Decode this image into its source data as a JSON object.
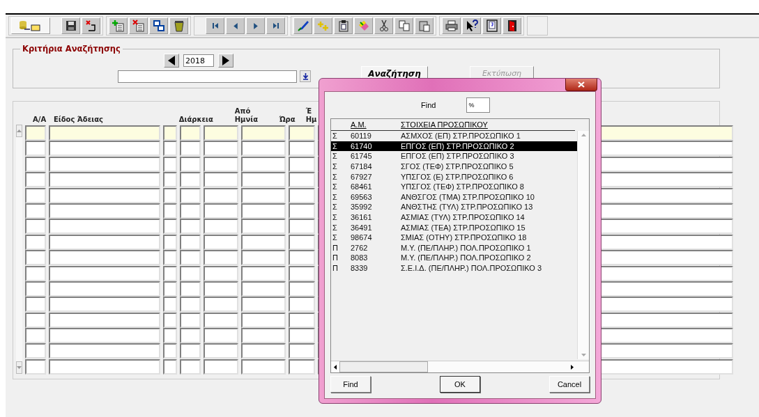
{
  "search_criteria": {
    "title": "Κριτήρια Αναζήτησης",
    "year": "2018",
    "search_button": "Αναζήτηση",
    "print_button": {
      "label": "Εκτύπωση",
      "disabled": true
    }
  },
  "grid": {
    "columns": [
      {
        "lines": [
          "Α/Α"
        ]
      },
      {
        "lines": [
          "Είδος Άδειας"
        ]
      },
      {},
      {
        "lines": [
          "Διάρκεια"
        ]
      },
      {},
      {
        "lines": [
          "Από",
          "Ημνία"
        ]
      },
      {
        "lines": [
          "Ώρα"
        ]
      },
      {
        "lines": [
          "Έ",
          "Ημ"
        ]
      }
    ],
    "rows": [
      {
        "selected": true
      },
      {
        "selected": false
      },
      {
        "selected": false
      },
      {
        "selected": false
      },
      {
        "selected": false
      },
      {
        "selected": false
      },
      {
        "selected": false
      },
      {
        "selected": false
      },
      {
        "selected": false
      },
      {
        "selected": false
      },
      {
        "selected": false
      },
      {
        "selected": false
      },
      {
        "selected": false
      },
      {
        "selected": false
      },
      {
        "selected": false
      },
      {
        "selected": false
      }
    ]
  },
  "dialog": {
    "find_label": "Find",
    "find_value": "%",
    "columns": [
      "Α.Μ.",
      "ΣΤΟΙΧΕΙΑ ΠΡΟΣΩΠΙΚΟΥ"
    ],
    "rows": [
      {
        "type": "Σ",
        "am": "60119",
        "name": "ΑΣΜΧΟΣ (ΕΠ) ΣΤΡ.ΠΡΟΣΩΠΙΚΟ 1",
        "selected": false
      },
      {
        "type": "Σ",
        "am": "61740",
        "name": "ΕΠΓΟΣ (ΕΠ) ΣΤΡ.ΠΡΟΣΩΠΙΚΟ 2",
        "selected": true
      },
      {
        "type": "Σ",
        "am": "61745",
        "name": "ΕΠΓΟΣ (ΕΠ) ΣΤΡ.ΠΡΟΣΩΠΙΚΟ 3",
        "selected": false
      },
      {
        "type": "Σ",
        "am": "67184",
        "name": "ΣΓΟΣ (ΤΕΦ) ΣΤΡ.ΠΡΟΣΩΠΙΚΟ 5",
        "selected": false
      },
      {
        "type": "Σ",
        "am": "67927",
        "name": "ΥΠΣΓΟΣ (Ε) ΣΤΡ.ΠΡΟΣΩΠΙΚΟ 6",
        "selected": false
      },
      {
        "type": "Σ",
        "am": "68461",
        "name": "ΥΠΣΓΟΣ (ΤΕΦ) ΣΤΡ.ΠΡΟΣΩΠΙΚΟ 8",
        "selected": false
      },
      {
        "type": "Σ",
        "am": "69563",
        "name": "ΑΝΘΣΓΟΣ (ΤΜΑ) ΣΤΡ.ΠΡΟΣΩΠΙΚΟ 10",
        "selected": false
      },
      {
        "type": "Σ",
        "am": "35992",
        "name": "ΑΝΘΣΤΗΣ (ΤΥΛ) ΣΤΡ.ΠΡΟΣΩΠΙΚΟ 13",
        "selected": false
      },
      {
        "type": "Σ",
        "am": "36161",
        "name": "ΑΣΜΙΑΣ (ΤΥΛ) ΣΤΡ.ΠΡΟΣΩΠΙΚΟ 14",
        "selected": false
      },
      {
        "type": "Σ",
        "am": "36491",
        "name": "ΑΣΜΙΑΣ (ΤΕΑ) ΣΤΡ.ΠΡΟΣΩΠΙΚΟ 15",
        "selected": false
      },
      {
        "type": "Σ",
        "am": "98674",
        "name": "ΣΜΙΑΣ (ΟΤΗΥ) ΣΤΡ.ΠΡΟΣΩΠΙΚΟ 18",
        "selected": false
      },
      {
        "type": "Π",
        "am": "2762",
        "name": "Μ.Υ. (ΠΕ/ΠΛΗΡ.) ΠΟΛ.ΠΡΟΣΩΠΙΚΟ 1",
        "selected": false
      },
      {
        "type": "Π",
        "am": "8083",
        "name": "Μ.Υ. (ΠΕ/ΠΛΗΡ.) ΠΟΛ.ΠΡΟΣΩΠΙΚΟ 2",
        "selected": false
      },
      {
        "type": "Π",
        "am": "8339",
        "name": "Σ.Ε.Ι.Δ. (ΠΕ/ΠΛΗΡ.) ΠΟΛ.ΠΡΟΣΩΠΙΚΟ 3",
        "selected": false
      }
    ],
    "buttons": [
      "Find",
      "OK",
      "Cancel"
    ]
  }
}
